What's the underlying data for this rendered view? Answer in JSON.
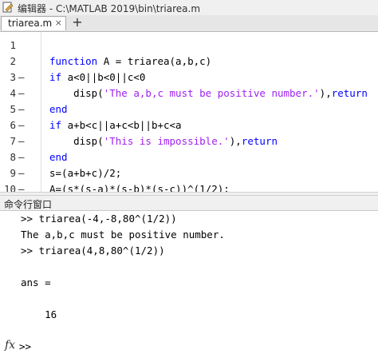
{
  "window": {
    "title": "编辑器 - C:\\MATLAB 2019\\bin\\triarea.m"
  },
  "tabs": [
    {
      "label": "triarea.m",
      "close": "×"
    }
  ],
  "add_tab": "+",
  "editor": {
    "lines": [
      {
        "num": "1",
        "bp": "",
        "segments": []
      },
      {
        "num": "2",
        "bp": "",
        "segments": [
          {
            "t": "kw",
            "v": "function"
          },
          {
            "t": "pl",
            "v": " A = triarea(a,b,c)"
          }
        ]
      },
      {
        "num": "3",
        "bp": "—",
        "segments": [
          {
            "t": "kw",
            "v": "if"
          },
          {
            "t": "pl",
            "v": " a<0||b<0||c<0"
          }
        ]
      },
      {
        "num": "4",
        "bp": "—",
        "segments": [
          {
            "t": "pl",
            "v": "    disp("
          },
          {
            "t": "str",
            "v": "'The a,b,c must be positive number.'"
          },
          {
            "t": "pl",
            "v": "),"
          },
          {
            "t": "kw",
            "v": "return"
          }
        ]
      },
      {
        "num": "5",
        "bp": "—",
        "segments": [
          {
            "t": "kw",
            "v": "end"
          }
        ]
      },
      {
        "num": "6",
        "bp": "—",
        "segments": [
          {
            "t": "kw",
            "v": "if"
          },
          {
            "t": "pl",
            "v": " a+b<c||a+c<b||b+c<a"
          }
        ]
      },
      {
        "num": "7",
        "bp": "—",
        "segments": [
          {
            "t": "pl",
            "v": "    disp("
          },
          {
            "t": "str",
            "v": "'This is impossible.'"
          },
          {
            "t": "pl",
            "v": "),"
          },
          {
            "t": "kw",
            "v": "return"
          }
        ]
      },
      {
        "num": "8",
        "bp": "—",
        "segments": [
          {
            "t": "kw",
            "v": "end"
          }
        ]
      },
      {
        "num": "9",
        "bp": "—",
        "segments": [
          {
            "t": "pl",
            "v": "s=(a+b+c)/2;"
          }
        ]
      },
      {
        "num": "10",
        "bp": "—",
        "segments": [
          {
            "t": "pl",
            "v": "A=(s*(s-a)*(s-b)*(s-c))^(1/2);"
          }
        ]
      }
    ]
  },
  "command_window": {
    "title": "命令行窗口",
    "lines": [
      ">> triarea(-4,-8,80^(1/2))",
      "The a,b,c must be positive number.",
      ">> triarea(4,8,80^(1/2))",
      "",
      "ans =",
      "",
      "    16"
    ],
    "fx": "fx",
    "prompt": ">>"
  },
  "colors": {
    "keyword": "#0000ff",
    "string": "#a020f0"
  }
}
